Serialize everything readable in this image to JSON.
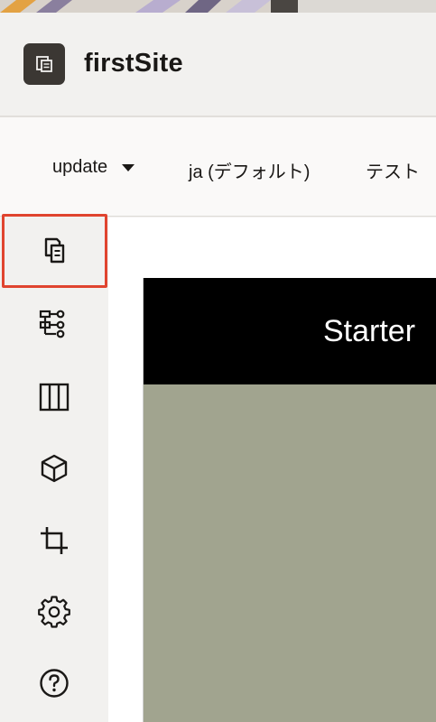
{
  "app": {
    "title": "firstSite",
    "logo_icon": "site-pages-icon"
  },
  "toolbar": {
    "update_label": "update",
    "language_label": "ja (デフォルト)",
    "test_label": "テスト"
  },
  "rail": {
    "items": [
      {
        "icon": "pages-icon",
        "selected": true
      },
      {
        "icon": "site-structure-icon",
        "selected": false
      },
      {
        "icon": "layout-columns-icon",
        "selected": false
      },
      {
        "icon": "component-cube-icon",
        "selected": false
      },
      {
        "icon": "crop-icon",
        "selected": false
      },
      {
        "icon": "settings-gear-icon",
        "selected": false
      },
      {
        "icon": "help-icon",
        "selected": false
      }
    ],
    "selection_color": "#e0442f"
  },
  "preview": {
    "banner_title": "Starter",
    "header_color": "#000000",
    "body_color": "#a1a48f"
  }
}
